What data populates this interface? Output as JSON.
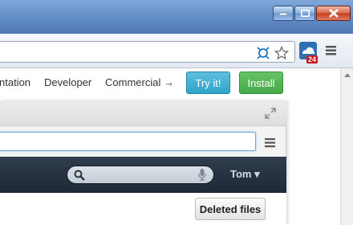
{
  "window": {
    "controls": [
      "minimize-icon",
      "maximize-icon",
      "close-icon"
    ]
  },
  "toolbar": {
    "omnibox_value": "",
    "icons": [
      "page-action-icon",
      "star-icon",
      "extension-cloud-icon",
      "menu-icon"
    ],
    "extension_badge": "24",
    "badge_color": "#c9161b"
  },
  "page_nav": {
    "partial_link": "ntation",
    "developer_link": "Developer",
    "commercial_link": "Commercial →",
    "try_button": "Try it!",
    "install_button": "Install",
    "try_color": "#3aaed2",
    "install_color": "#52b552"
  },
  "panel": {
    "input_value": "",
    "search_placeholder": "",
    "user_menu": "Tom ▾",
    "deleted_files_button": "Deleted files"
  }
}
